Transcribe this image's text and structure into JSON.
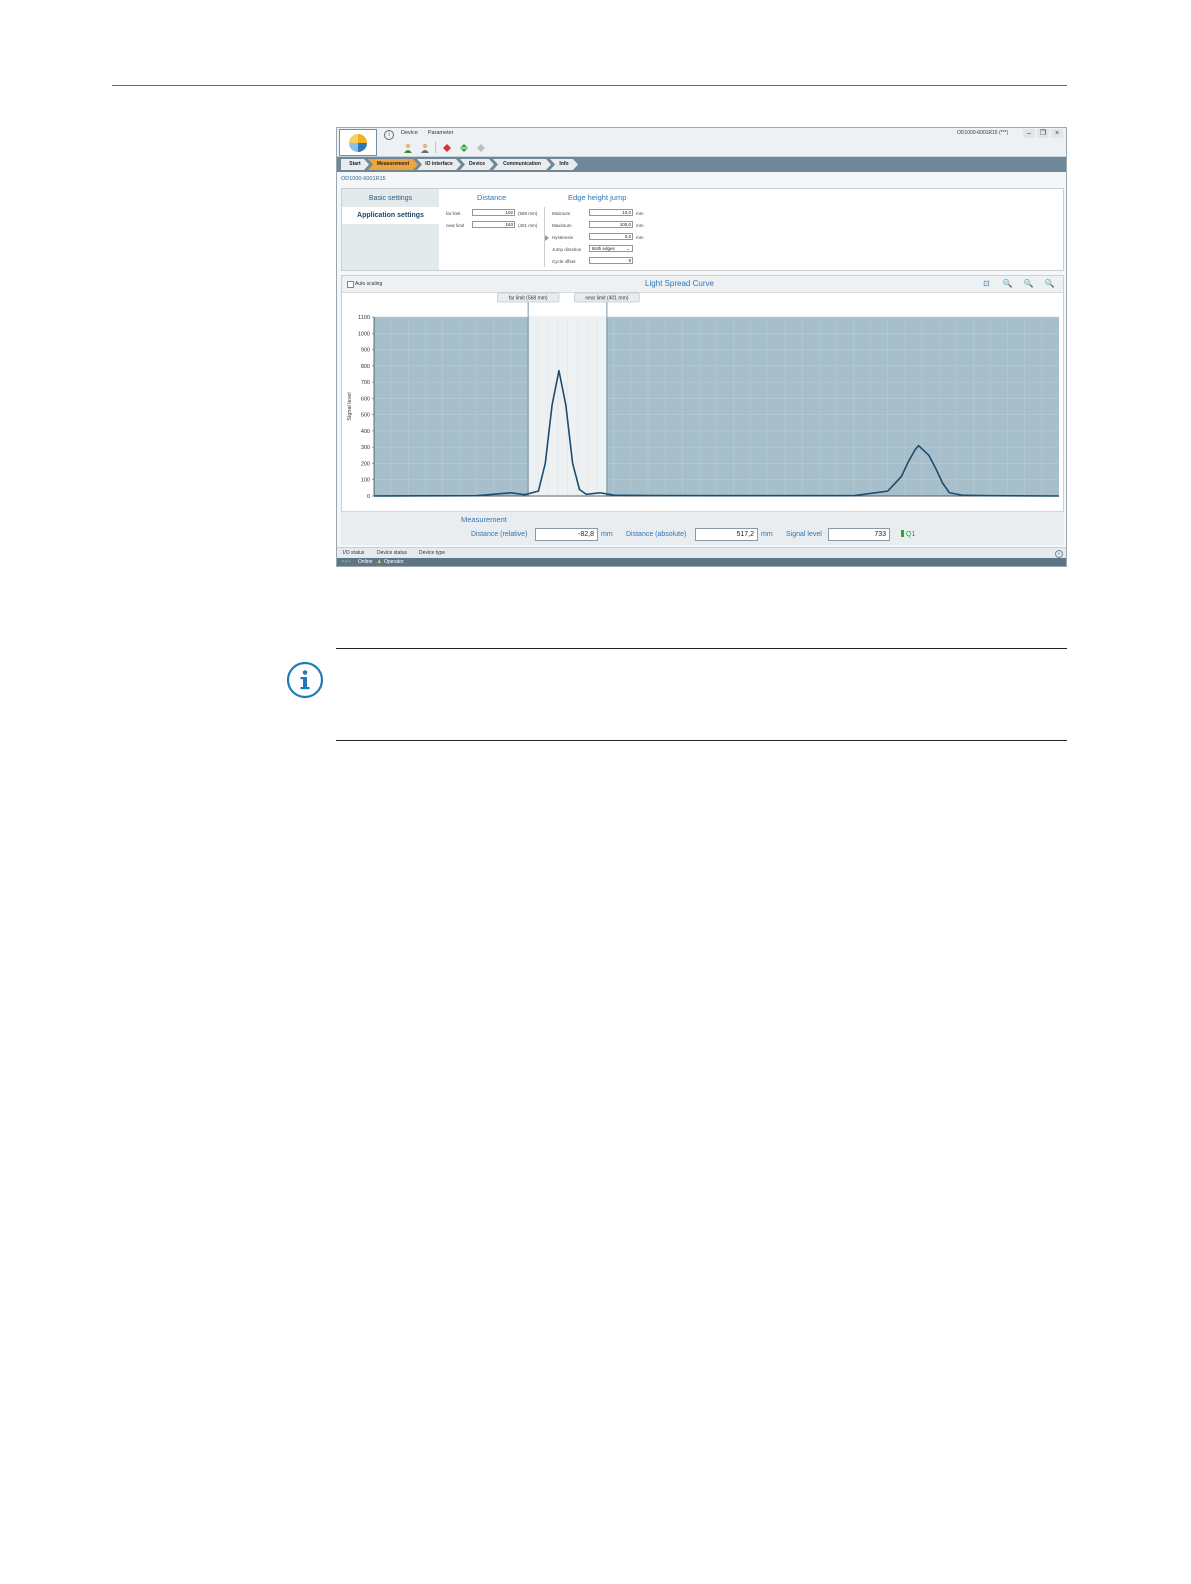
{
  "app": {
    "menu": [
      "Device",
      "Parameter"
    ],
    "device_title": "OD1000-6001R15 (***)",
    "device_id": "OD1000-6001R15",
    "breadcrumbs": [
      "Start",
      "Measurement",
      "IO interface",
      "Device",
      "Communication",
      "Info"
    ],
    "active_crumb": "Measurement",
    "toolbar_icons": [
      "user-login-icon",
      "user-logout-icon",
      "read-from-device-icon",
      "write-to-device-icon",
      "compare-icon"
    ]
  },
  "settings": {
    "tabs": [
      "Basic settings",
      "Application settings"
    ],
    "distance": {
      "title": "Distance",
      "far_limit": {
        "label": "far limit",
        "value": "102",
        "note": "(568 mm)"
      },
      "near_limit": {
        "label": "near limit",
        "value": "163",
        "note": "(401 mm)"
      }
    },
    "edge": {
      "title": "Edge height jump",
      "minimum": {
        "label": "Minimum",
        "value": "10,0",
        "unit": "mm"
      },
      "maximum": {
        "label": "Maximum",
        "value": "100,0",
        "unit": "mm"
      },
      "hysteresis": {
        "label": "Hysteresis",
        "value": "0,5",
        "unit": "mm"
      },
      "jump_direction": {
        "label": "Jump direction",
        "value": "Both edges"
      },
      "cycle_offset": {
        "label": "Cycle offset",
        "value": "8"
      }
    }
  },
  "chart": {
    "auto_scaling_label": "Auto scaling",
    "title": "Light Spread Curve",
    "far_limit_marker": "far limit (568 mm)",
    "near_limit_marker": "near limit (401 mm)"
  },
  "chart_data": {
    "type": "line",
    "title": "Light Spread Curve",
    "ylabel": "Signal level",
    "xlabel": "",
    "ylim": [
      0,
      1100
    ],
    "yticks": [
      "1100",
      "1000",
      "900",
      "800",
      "700",
      "600",
      "500",
      "400",
      "300",
      "200",
      "100",
      "0"
    ],
    "x_range": [
      0,
      100
    ],
    "grid": true,
    "series": [
      {
        "x": [
          0,
          15,
          20,
          22,
          24,
          25,
          26,
          27,
          28,
          29,
          30,
          31,
          32,
          33,
          35,
          40,
          50,
          70,
          75,
          77,
          78,
          79,
          79.5,
          80,
          81,
          82,
          83,
          84,
          86,
          90,
          100
        ],
        "y": [
          0,
          2,
          20,
          8,
          30,
          200,
          560,
          770,
          560,
          200,
          40,
          10,
          15,
          20,
          5,
          3,
          2,
          2,
          30,
          120,
          210,
          285,
          310,
          290,
          250,
          170,
          80,
          20,
          4,
          2,
          0
        ]
      }
    ],
    "shaded_window": {
      "from": 22.5,
      "to": 34
    }
  },
  "measurement": {
    "title": "Measurement",
    "distance_relative": {
      "label": "Distance (relative)",
      "value": "-82,8",
      "unit": "mm"
    },
    "distance_absolute": {
      "label": "Distance (absolute)",
      "value": "517,2",
      "unit": "mm"
    },
    "signal_level": {
      "label": "Signal level",
      "value": "733"
    },
    "output": "Q1"
  },
  "status": {
    "items": [
      "I/O status",
      "Device status",
      "Device type"
    ],
    "online": "Online",
    "user": "Operator"
  }
}
